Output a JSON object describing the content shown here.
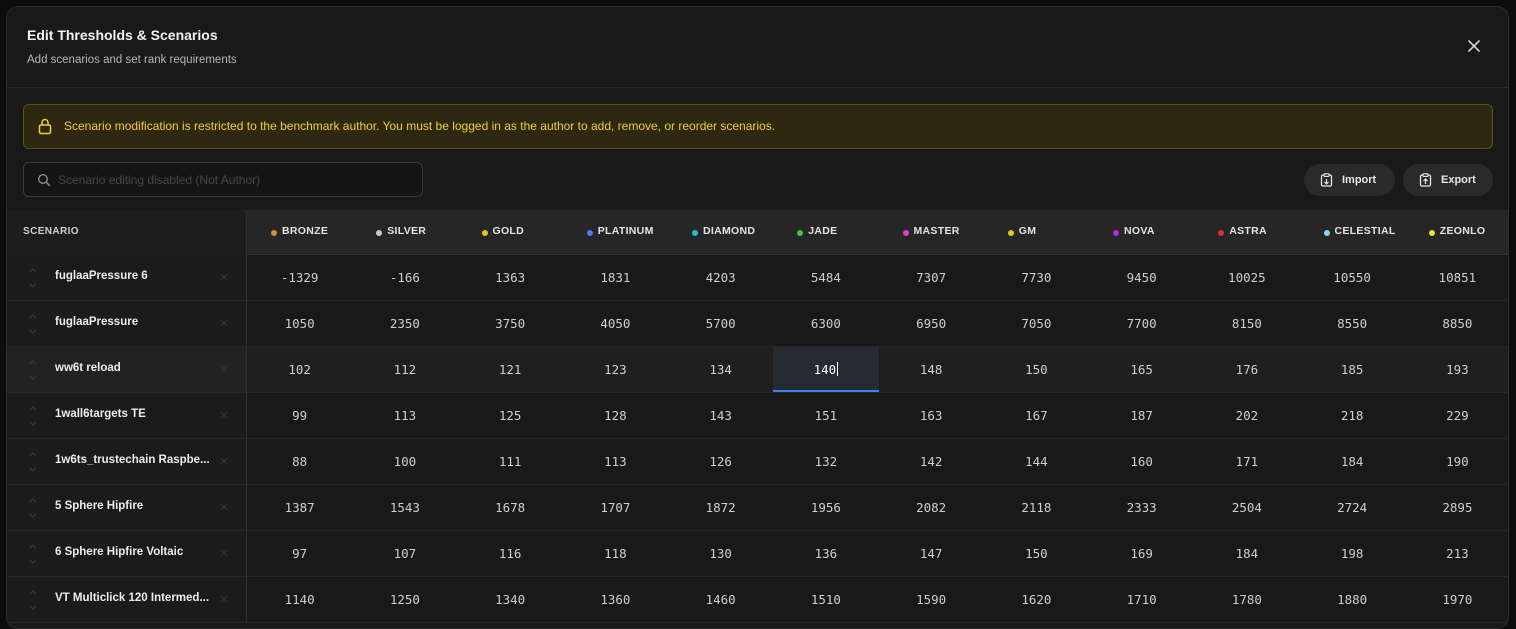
{
  "modal": {
    "title": "Edit Thresholds & Scenarios",
    "subtitle": "Add scenarios and set rank requirements"
  },
  "warning": {
    "text": "Scenario modification is restricted to the benchmark author. You must be logged in as the author to add, remove, or reorder scenarios."
  },
  "search": {
    "placeholder": "Scenario editing disabled (Not Author)",
    "value": ""
  },
  "toolbar": {
    "import_label": "Import",
    "export_label": "Export"
  },
  "table": {
    "scenario_header": "SCENARIO",
    "ranks": [
      {
        "name": "BRONZE",
        "color": "#d98a3d"
      },
      {
        "name": "SILVER",
        "color": "#c9c9c9"
      },
      {
        "name": "GOLD",
        "color": "#f2c01e"
      },
      {
        "name": "PLATINUM",
        "color": "#4a7df0"
      },
      {
        "name": "DIAMOND",
        "color": "#23b8d6"
      },
      {
        "name": "JADE",
        "color": "#2fd14a"
      },
      {
        "name": "MASTER",
        "color": "#e23ad6"
      },
      {
        "name": "GM",
        "color": "#f0c419"
      },
      {
        "name": "NOVA",
        "color": "#b42ad8"
      },
      {
        "name": "ASTRA",
        "color": "#e8283c"
      },
      {
        "name": "CELESTIAL",
        "color": "#7fd8f2"
      },
      {
        "name": "ZEONLO",
        "color": "#e6e62a"
      }
    ],
    "rows": [
      {
        "name": "fuglaaPressure 6",
        "values": [
          "-1329",
          "-166",
          "1363",
          "1831",
          "4203",
          "5484",
          "7307",
          "7730",
          "9450",
          "10025",
          "10550",
          "10851"
        ]
      },
      {
        "name": "fuglaaPressure",
        "values": [
          "1050",
          "2350",
          "3750",
          "4050",
          "5700",
          "6300",
          "6950",
          "7050",
          "7700",
          "8150",
          "8550",
          "8850"
        ]
      },
      {
        "name": "ww6t reload",
        "values": [
          "102",
          "112",
          "121",
          "123",
          "134",
          "140",
          "148",
          "150",
          "165",
          "176",
          "185",
          "193"
        ]
      },
      {
        "name": "1wall6targets TE",
        "values": [
          "99",
          "113",
          "125",
          "128",
          "143",
          "151",
          "163",
          "167",
          "187",
          "202",
          "218",
          "229"
        ]
      },
      {
        "name": "1w6ts_trustechain Raspbe...",
        "values": [
          "88",
          "100",
          "111",
          "113",
          "126",
          "132",
          "142",
          "144",
          "160",
          "171",
          "184",
          "190"
        ]
      },
      {
        "name": "5 Sphere Hipfire",
        "values": [
          "1387",
          "1543",
          "1678",
          "1707",
          "1872",
          "1956",
          "2082",
          "2118",
          "2333",
          "2504",
          "2724",
          "2895"
        ]
      },
      {
        "name": "6 Sphere Hipfire Voltaic",
        "values": [
          "97",
          "107",
          "116",
          "118",
          "130",
          "136",
          "147",
          "150",
          "169",
          "184",
          "198",
          "213"
        ]
      },
      {
        "name": "VT Multiclick 120 Intermed...",
        "values": [
          "1140",
          "1250",
          "1340",
          "1360",
          "1460",
          "1510",
          "1590",
          "1620",
          "1710",
          "1780",
          "1880",
          "1970"
        ]
      }
    ],
    "active_cell": {
      "row": 2,
      "col": 5
    }
  }
}
